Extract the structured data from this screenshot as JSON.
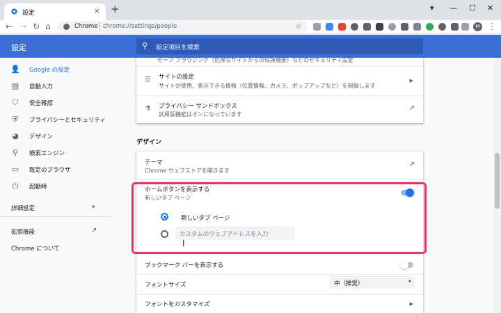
{
  "window": {
    "tab_title": "設定",
    "close_glyph": "×",
    "new_tab_glyph": "+",
    "controls": {
      "minimize": "—",
      "maximize": "☐",
      "close": "✕"
    },
    "profile_indicator": "▾"
  },
  "toolbar": {
    "back": "←",
    "forward": "→",
    "reload": "↻",
    "home": "⌂",
    "site_label": "Chrome",
    "url": "chrome://settings/people",
    "star": "☆",
    "avatar_letter": "M",
    "menu": "⋮"
  },
  "header": {
    "title": "設定",
    "search_placeholder": "設定項目を検索",
    "search_icon": "⚲"
  },
  "sidebar": {
    "items": [
      {
        "label": "Google の設定",
        "icon": "👤",
        "active": true
      },
      {
        "label": "自動入力",
        "icon": "▤",
        "active": false
      },
      {
        "label": "安全確認",
        "icon": "⛉",
        "active": false
      },
      {
        "label": "プライバシーとセキュリティ",
        "icon": "⛨",
        "active": false
      },
      {
        "label": "デザイン",
        "icon": "◕",
        "active": false
      },
      {
        "label": "検索エンジン",
        "icon": "⚲",
        "active": false
      },
      {
        "label": "既定のブラウザ",
        "icon": "▭",
        "active": false
      },
      {
        "label": "起動時",
        "icon": "⏻",
        "active": false
      }
    ],
    "advanced_label": "詳細設定",
    "advanced_caret": "▾",
    "extensions_label": "拡張機能",
    "extensions_icon": "↗",
    "about_label": "Chrome について"
  },
  "privacy_card": {
    "partial_text": "セーフ ブラウジング（危険なサイトからの保護機能）などのセキュリティ設定",
    "site_settings": {
      "title": "サイトの設定",
      "subtitle": "サイトが使用、表示できる情報（位置情報、カメラ、ポップアップなど）を制御します",
      "icon": "☰",
      "chevron": "▸"
    },
    "sandbox": {
      "title": "プライバシー サンドボックス",
      "subtitle": "試用版機能はオンになっています",
      "icon": "⚗",
      "link_icon": "↗"
    }
  },
  "design_section": {
    "title": "デザイン",
    "theme": {
      "title": "テーマ",
      "subtitle": "Chrome ウェブストアを開きます",
      "link_icon": "↗"
    },
    "home_button": {
      "title": "ホームボタンを表示する",
      "subtitle": "新しいタブ ページ",
      "enabled": true,
      "option_new_tab": "新しいタブ ページ",
      "custom_placeholder": "カスタムのウェブアドレスを入力",
      "selected": "new_tab"
    },
    "bookmarks_bar": {
      "title": "ブックマーク バーを表示する",
      "enabled": false
    },
    "font_size": {
      "title": "フォントサイズ",
      "value": "中（推奨）",
      "caret": "▾"
    },
    "customize_fonts": {
      "title": "フォントをカスタマイズ",
      "chevron": "▸"
    }
  },
  "cursor_glyph": "I",
  "colors": {
    "accent": "#1a73e8",
    "header_bg": "#3c6ed7",
    "highlight": "#e8336a",
    "toggle_on_track": "#8ab4f8",
    "toggle_off_track": "#bdc1c6"
  }
}
